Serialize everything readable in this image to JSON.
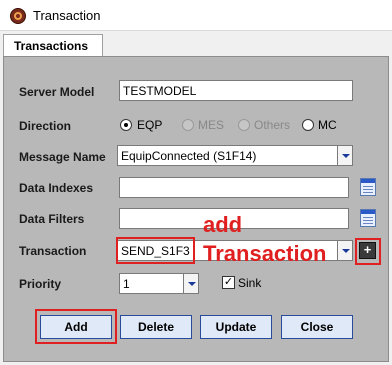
{
  "window": {
    "title": "Transaction",
    "icon": "app-icon"
  },
  "tabs": [
    {
      "label": "Transactions"
    }
  ],
  "form": {
    "server_model": {
      "label": "Server Model",
      "value": "TESTMODEL"
    },
    "direction": {
      "label": "Direction",
      "options": [
        {
          "label": "EQP",
          "checked": true,
          "enabled": true
        },
        {
          "label": "MES",
          "checked": false,
          "enabled": false
        },
        {
          "label": "Others",
          "checked": false,
          "enabled": false
        },
        {
          "label": "MC",
          "checked": false,
          "enabled": true
        }
      ]
    },
    "message_name": {
      "label": "Message Name",
      "value": "EquipConnected (S1F14)"
    },
    "data_indexes": {
      "label": "Data Indexes",
      "value": "",
      "icon": "notepad-icon"
    },
    "data_filters": {
      "label": "Data Filters",
      "value": "",
      "icon": "notepad-icon"
    },
    "transaction": {
      "label": "Transaction",
      "value": "SEND_S1F3",
      "add_icon": "plus-icon",
      "add_symbol": "+"
    },
    "priority": {
      "label": "Priority",
      "value": "1"
    },
    "sink": {
      "label": "Sink",
      "checked": true,
      "check_mark": "✓"
    }
  },
  "buttons": {
    "add": "Add",
    "delete": "Delete",
    "update": "Update",
    "close": "Close"
  },
  "annotation": {
    "line1": "add",
    "line2": "Transaction",
    "color": "#e02020"
  }
}
